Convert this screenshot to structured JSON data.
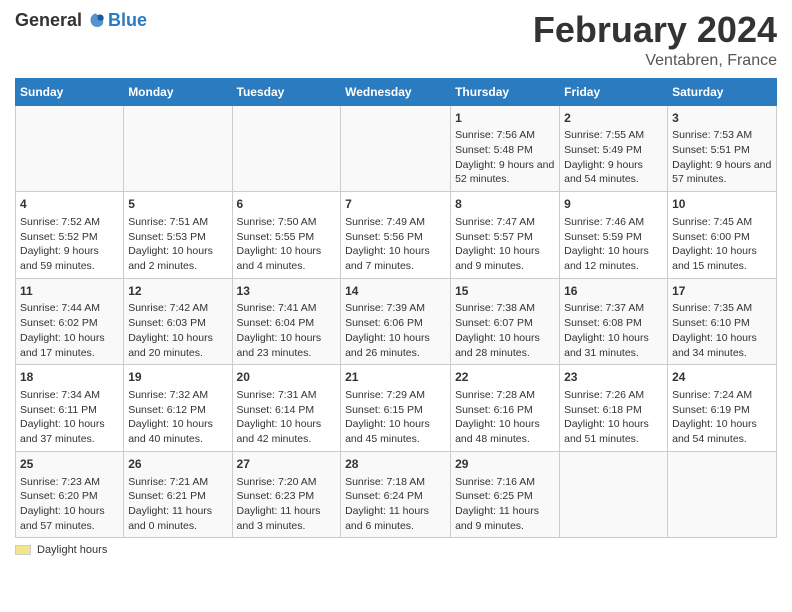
{
  "header": {
    "logo_general": "General",
    "logo_blue": "Blue",
    "title": "February 2024",
    "subtitle": "Ventabren, France"
  },
  "columns": [
    "Sunday",
    "Monday",
    "Tuesday",
    "Wednesday",
    "Thursday",
    "Friday",
    "Saturday"
  ],
  "footer": {
    "daylight_label": "Daylight hours"
  },
  "weeks": [
    [
      {
        "day": "",
        "info": ""
      },
      {
        "day": "",
        "info": ""
      },
      {
        "day": "",
        "info": ""
      },
      {
        "day": "",
        "info": ""
      },
      {
        "day": "1",
        "info": "Sunrise: 7:56 AM\nSunset: 5:48 PM\nDaylight: 9 hours and 52 minutes."
      },
      {
        "day": "2",
        "info": "Sunrise: 7:55 AM\nSunset: 5:49 PM\nDaylight: 9 hours and 54 minutes."
      },
      {
        "day": "3",
        "info": "Sunrise: 7:53 AM\nSunset: 5:51 PM\nDaylight: 9 hours and 57 minutes."
      }
    ],
    [
      {
        "day": "4",
        "info": "Sunrise: 7:52 AM\nSunset: 5:52 PM\nDaylight: 9 hours and 59 minutes."
      },
      {
        "day": "5",
        "info": "Sunrise: 7:51 AM\nSunset: 5:53 PM\nDaylight: 10 hours and 2 minutes."
      },
      {
        "day": "6",
        "info": "Sunrise: 7:50 AM\nSunset: 5:55 PM\nDaylight: 10 hours and 4 minutes."
      },
      {
        "day": "7",
        "info": "Sunrise: 7:49 AM\nSunset: 5:56 PM\nDaylight: 10 hours and 7 minutes."
      },
      {
        "day": "8",
        "info": "Sunrise: 7:47 AM\nSunset: 5:57 PM\nDaylight: 10 hours and 9 minutes."
      },
      {
        "day": "9",
        "info": "Sunrise: 7:46 AM\nSunset: 5:59 PM\nDaylight: 10 hours and 12 minutes."
      },
      {
        "day": "10",
        "info": "Sunrise: 7:45 AM\nSunset: 6:00 PM\nDaylight: 10 hours and 15 minutes."
      }
    ],
    [
      {
        "day": "11",
        "info": "Sunrise: 7:44 AM\nSunset: 6:02 PM\nDaylight: 10 hours and 17 minutes."
      },
      {
        "day": "12",
        "info": "Sunrise: 7:42 AM\nSunset: 6:03 PM\nDaylight: 10 hours and 20 minutes."
      },
      {
        "day": "13",
        "info": "Sunrise: 7:41 AM\nSunset: 6:04 PM\nDaylight: 10 hours and 23 minutes."
      },
      {
        "day": "14",
        "info": "Sunrise: 7:39 AM\nSunset: 6:06 PM\nDaylight: 10 hours and 26 minutes."
      },
      {
        "day": "15",
        "info": "Sunrise: 7:38 AM\nSunset: 6:07 PM\nDaylight: 10 hours and 28 minutes."
      },
      {
        "day": "16",
        "info": "Sunrise: 7:37 AM\nSunset: 6:08 PM\nDaylight: 10 hours and 31 minutes."
      },
      {
        "day": "17",
        "info": "Sunrise: 7:35 AM\nSunset: 6:10 PM\nDaylight: 10 hours and 34 minutes."
      }
    ],
    [
      {
        "day": "18",
        "info": "Sunrise: 7:34 AM\nSunset: 6:11 PM\nDaylight: 10 hours and 37 minutes."
      },
      {
        "day": "19",
        "info": "Sunrise: 7:32 AM\nSunset: 6:12 PM\nDaylight: 10 hours and 40 minutes."
      },
      {
        "day": "20",
        "info": "Sunrise: 7:31 AM\nSunset: 6:14 PM\nDaylight: 10 hours and 42 minutes."
      },
      {
        "day": "21",
        "info": "Sunrise: 7:29 AM\nSunset: 6:15 PM\nDaylight: 10 hours and 45 minutes."
      },
      {
        "day": "22",
        "info": "Sunrise: 7:28 AM\nSunset: 6:16 PM\nDaylight: 10 hours and 48 minutes."
      },
      {
        "day": "23",
        "info": "Sunrise: 7:26 AM\nSunset: 6:18 PM\nDaylight: 10 hours and 51 minutes."
      },
      {
        "day": "24",
        "info": "Sunrise: 7:24 AM\nSunset: 6:19 PM\nDaylight: 10 hours and 54 minutes."
      }
    ],
    [
      {
        "day": "25",
        "info": "Sunrise: 7:23 AM\nSunset: 6:20 PM\nDaylight: 10 hours and 57 minutes."
      },
      {
        "day": "26",
        "info": "Sunrise: 7:21 AM\nSunset: 6:21 PM\nDaylight: 11 hours and 0 minutes."
      },
      {
        "day": "27",
        "info": "Sunrise: 7:20 AM\nSunset: 6:23 PM\nDaylight: 11 hours and 3 minutes."
      },
      {
        "day": "28",
        "info": "Sunrise: 7:18 AM\nSunset: 6:24 PM\nDaylight: 11 hours and 6 minutes."
      },
      {
        "day": "29",
        "info": "Sunrise: 7:16 AM\nSunset: 6:25 PM\nDaylight: 11 hours and 9 minutes."
      },
      {
        "day": "",
        "info": ""
      },
      {
        "day": "",
        "info": ""
      }
    ]
  ]
}
